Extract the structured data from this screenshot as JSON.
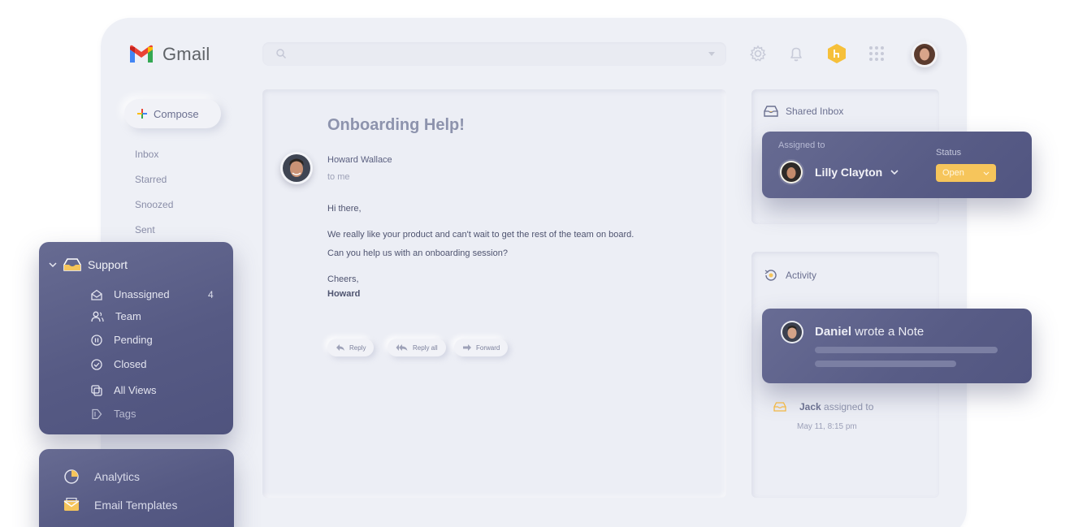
{
  "app": {
    "name": "Gmail"
  },
  "compose": {
    "label": "Compose"
  },
  "nav": {
    "items": [
      "Inbox",
      "Starred",
      "Snoozed",
      "Sent"
    ]
  },
  "email": {
    "subject": "Onboarding Help!",
    "sender": "Howard Wallace",
    "to": "to me",
    "body": [
      "Hi there,",
      "We really like your product and can't wait to get the rest of the team on board.",
      "Can you help us with an onboarding session?",
      "Cheers,",
      "Howard"
    ],
    "actions": [
      "Reply",
      "Reply all",
      "Forward"
    ]
  },
  "shared_inbox": {
    "title": "Shared Inbox",
    "assigned_label": "Assigned to",
    "assignee": "Lilly Clayton",
    "status_label": "Status",
    "status_value": "Open"
  },
  "activity": {
    "title": "Activity",
    "note_actor": "Daniel",
    "note_text": "wrote a Note",
    "event_actor": "Jack",
    "event_text": "assigned to",
    "event_time": "May 11, 8:15 pm"
  },
  "support": {
    "title": "Support",
    "items": [
      {
        "label": "Unassigned",
        "count": "4",
        "icon": "envelope-open-icon"
      },
      {
        "label": "Team",
        "icon": "team-icon"
      },
      {
        "label": "Pending",
        "icon": "pause-circle-icon"
      },
      {
        "label": "Closed",
        "icon": "check-circle-icon"
      },
      {
        "label": "All Views",
        "icon": "copy-icon"
      },
      {
        "label": "Tags",
        "icon": "tag-icon"
      }
    ]
  },
  "tools": {
    "items": [
      {
        "label": "Analytics",
        "icon": "pie-chart-icon"
      },
      {
        "label": "Email Templates",
        "icon": "email-template-icon"
      }
    ]
  },
  "colors": {
    "panel": "#585c86",
    "accent_yellow": "#f6c55b",
    "background": "#eef0f6"
  }
}
